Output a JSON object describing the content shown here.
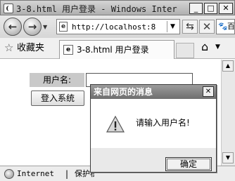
{
  "window": {
    "title": "3-8.html 用户登录 - Windows Inter...",
    "min_glyph": "_",
    "max_glyph": "□",
    "close_glyph": "✕"
  },
  "navbar": {
    "address": "http://localhost:8",
    "search_text": "百度"
  },
  "favorites": {
    "label": "收藏夹",
    "tab_label": "3-8.html 用户登录"
  },
  "page": {
    "username_label": "用户名:",
    "username_value": "",
    "login_button": "登入系统"
  },
  "dialog": {
    "title": "来自网页的消息",
    "message": "请输入用户名!",
    "ok_label": "确定"
  },
  "status": {
    "zone": "Internet",
    "separator": "|",
    "protected_mode": "保护模式"
  }
}
